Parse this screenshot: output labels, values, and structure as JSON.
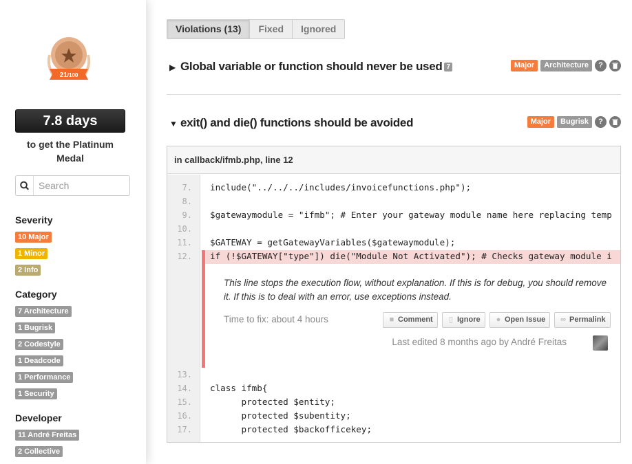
{
  "sidebar": {
    "medal": {
      "score": "21",
      "max": "/100"
    },
    "days": "7.8 days",
    "days_sub": "to get the Platinum Medal",
    "search_placeholder": "Search",
    "severity": {
      "title": "Severity",
      "items": [
        {
          "label": "10 Major",
          "color": "#f47c3c"
        },
        {
          "label": "1 Minor",
          "color": "#f0b400"
        },
        {
          "label": "2 Info",
          "color": "#bbaa70"
        }
      ]
    },
    "category": {
      "title": "Category",
      "items": [
        {
          "label": "7 Architecture"
        },
        {
          "label": "1 Bugrisk"
        },
        {
          "label": "2 Codestyle"
        },
        {
          "label": "1 Deadcode"
        },
        {
          "label": "1 Performance"
        },
        {
          "label": "1 Security"
        }
      ]
    },
    "developer": {
      "title": "Developer",
      "items": [
        {
          "label": "11 André Freitas"
        },
        {
          "label": "2 Collective"
        }
      ]
    }
  },
  "tabs": [
    {
      "label": "Violations (13)"
    },
    {
      "label": "Fixed"
    },
    {
      "label": "Ignored"
    }
  ],
  "violations": [
    {
      "title": "Global variable or function should never be used",
      "count": "7",
      "severity": "Major",
      "category": "Architecture"
    },
    {
      "title": "exit() and die() functions should be avoided",
      "severity": "Major",
      "category": "Bugrisk"
    }
  ],
  "snippet": {
    "file": "in callback/ifmb.php, line 12",
    "lines_before": [
      {
        "n": "7.",
        "code": "include(\"../../../includes/invoicefunctions.php\");"
      },
      {
        "n": "8.",
        "code": ""
      },
      {
        "n": "9.",
        "code": "$gatewaymodule = \"ifmb\"; # Enter your gateway module name here replacing temp"
      },
      {
        "n": "10.",
        "code": ""
      },
      {
        "n": "11.",
        "code": "$GATEWAY = getGatewayVariables($gatewaymodule);"
      },
      {
        "n": "12.",
        "code": "if (!$GATEWAY[\"type\"]) die(\"Module Not Activated\"); # Checks gateway module i"
      }
    ],
    "lines_after": [
      {
        "n": "13.",
        "code": ""
      },
      {
        "n": "14.",
        "code": "class ifmb{"
      },
      {
        "n": "15.",
        "code": "      protected $entity;"
      },
      {
        "n": "16.",
        "code": "      protected $subentity;"
      },
      {
        "n": "17.",
        "code": "      protected $backofficekey;"
      }
    ],
    "issue": {
      "message": "This line stops the execution flow, without explanation. If this is for debug, you should remove it. If this is to deal with an error, use exceptions instead.",
      "time_to_fix": "Time to fix: about 4 hours",
      "actions": [
        {
          "label": "Comment",
          "icon": "comment-icon"
        },
        {
          "label": "Ignore",
          "icon": "trash-icon"
        },
        {
          "label": "Open Issue",
          "icon": "github-icon"
        },
        {
          "label": "Permalink",
          "icon": "link-icon"
        }
      ],
      "edited": "Last edited 8 months ago by André Freitas"
    }
  },
  "colors": {
    "major": "#f47c3c",
    "category_gray": "#999999",
    "highlight": "#f8d7d7",
    "highlight_border": "#f07878"
  }
}
